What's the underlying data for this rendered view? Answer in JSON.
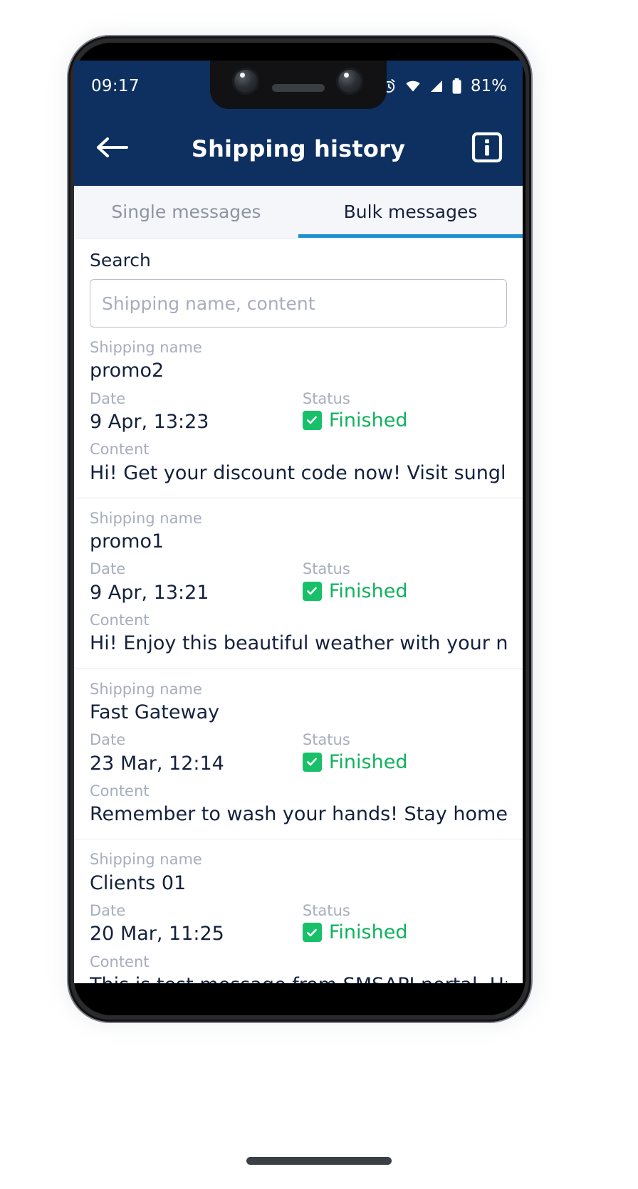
{
  "statusbar": {
    "time": "09:17",
    "battery_percent": "81%",
    "icons": [
      "alarm-icon",
      "wifi-icon",
      "signal-icon",
      "battery-icon"
    ]
  },
  "appbar": {
    "title": "Shipping history",
    "back_icon": "arrow-left-icon",
    "info_icon": "info-icon"
  },
  "tabs": [
    {
      "label": "Single messages",
      "active": false
    },
    {
      "label": "Bulk messages",
      "active": true
    }
  ],
  "search": {
    "label": "Search",
    "value": "",
    "placeholder": "Shipping name, content"
  },
  "labels": {
    "shipping_name": "Shipping name",
    "date": "Date",
    "status": "Status",
    "content": "Content"
  },
  "colors": {
    "header_blue": "#0d3060",
    "tab_indicator": "#1e8fd0",
    "status_green": "#10b25e",
    "check_green": "#18c06a",
    "muted": "#a7adbd",
    "text": "#14213d"
  },
  "list": [
    {
      "shipping_name": "promo2",
      "date": "9 Apr, 13:23",
      "status": "Finished",
      "status_icon": "check-square-icon",
      "content": "Hi! Get your discount code now! Visit sunglastore.co..."
    },
    {
      "shipping_name": "promo1",
      "date": "9 Apr, 13:21",
      "status": "Finished",
      "status_icon": "check-square-icon",
      "content": "Hi! Enjoy this beautiful weather with your new pair of..."
    },
    {
      "shipping_name": "Fast Gateway",
      "date": "23 Mar, 12:14",
      "status": "Finished",
      "status_icon": "check-square-icon",
      "content": "Remember to wash your hands! Stay home, stay safe!"
    },
    {
      "shipping_name": "Clients 01",
      "date": "20 Mar, 11:25",
      "status": "Finished",
      "status_icon": "check-square-icon",
      "content": "This is test message from SMSAPI portal. Have a nic..."
    }
  ],
  "navbar": {
    "back_icon": "chevron-left-icon",
    "home_pill": "home-pill-handle"
  }
}
